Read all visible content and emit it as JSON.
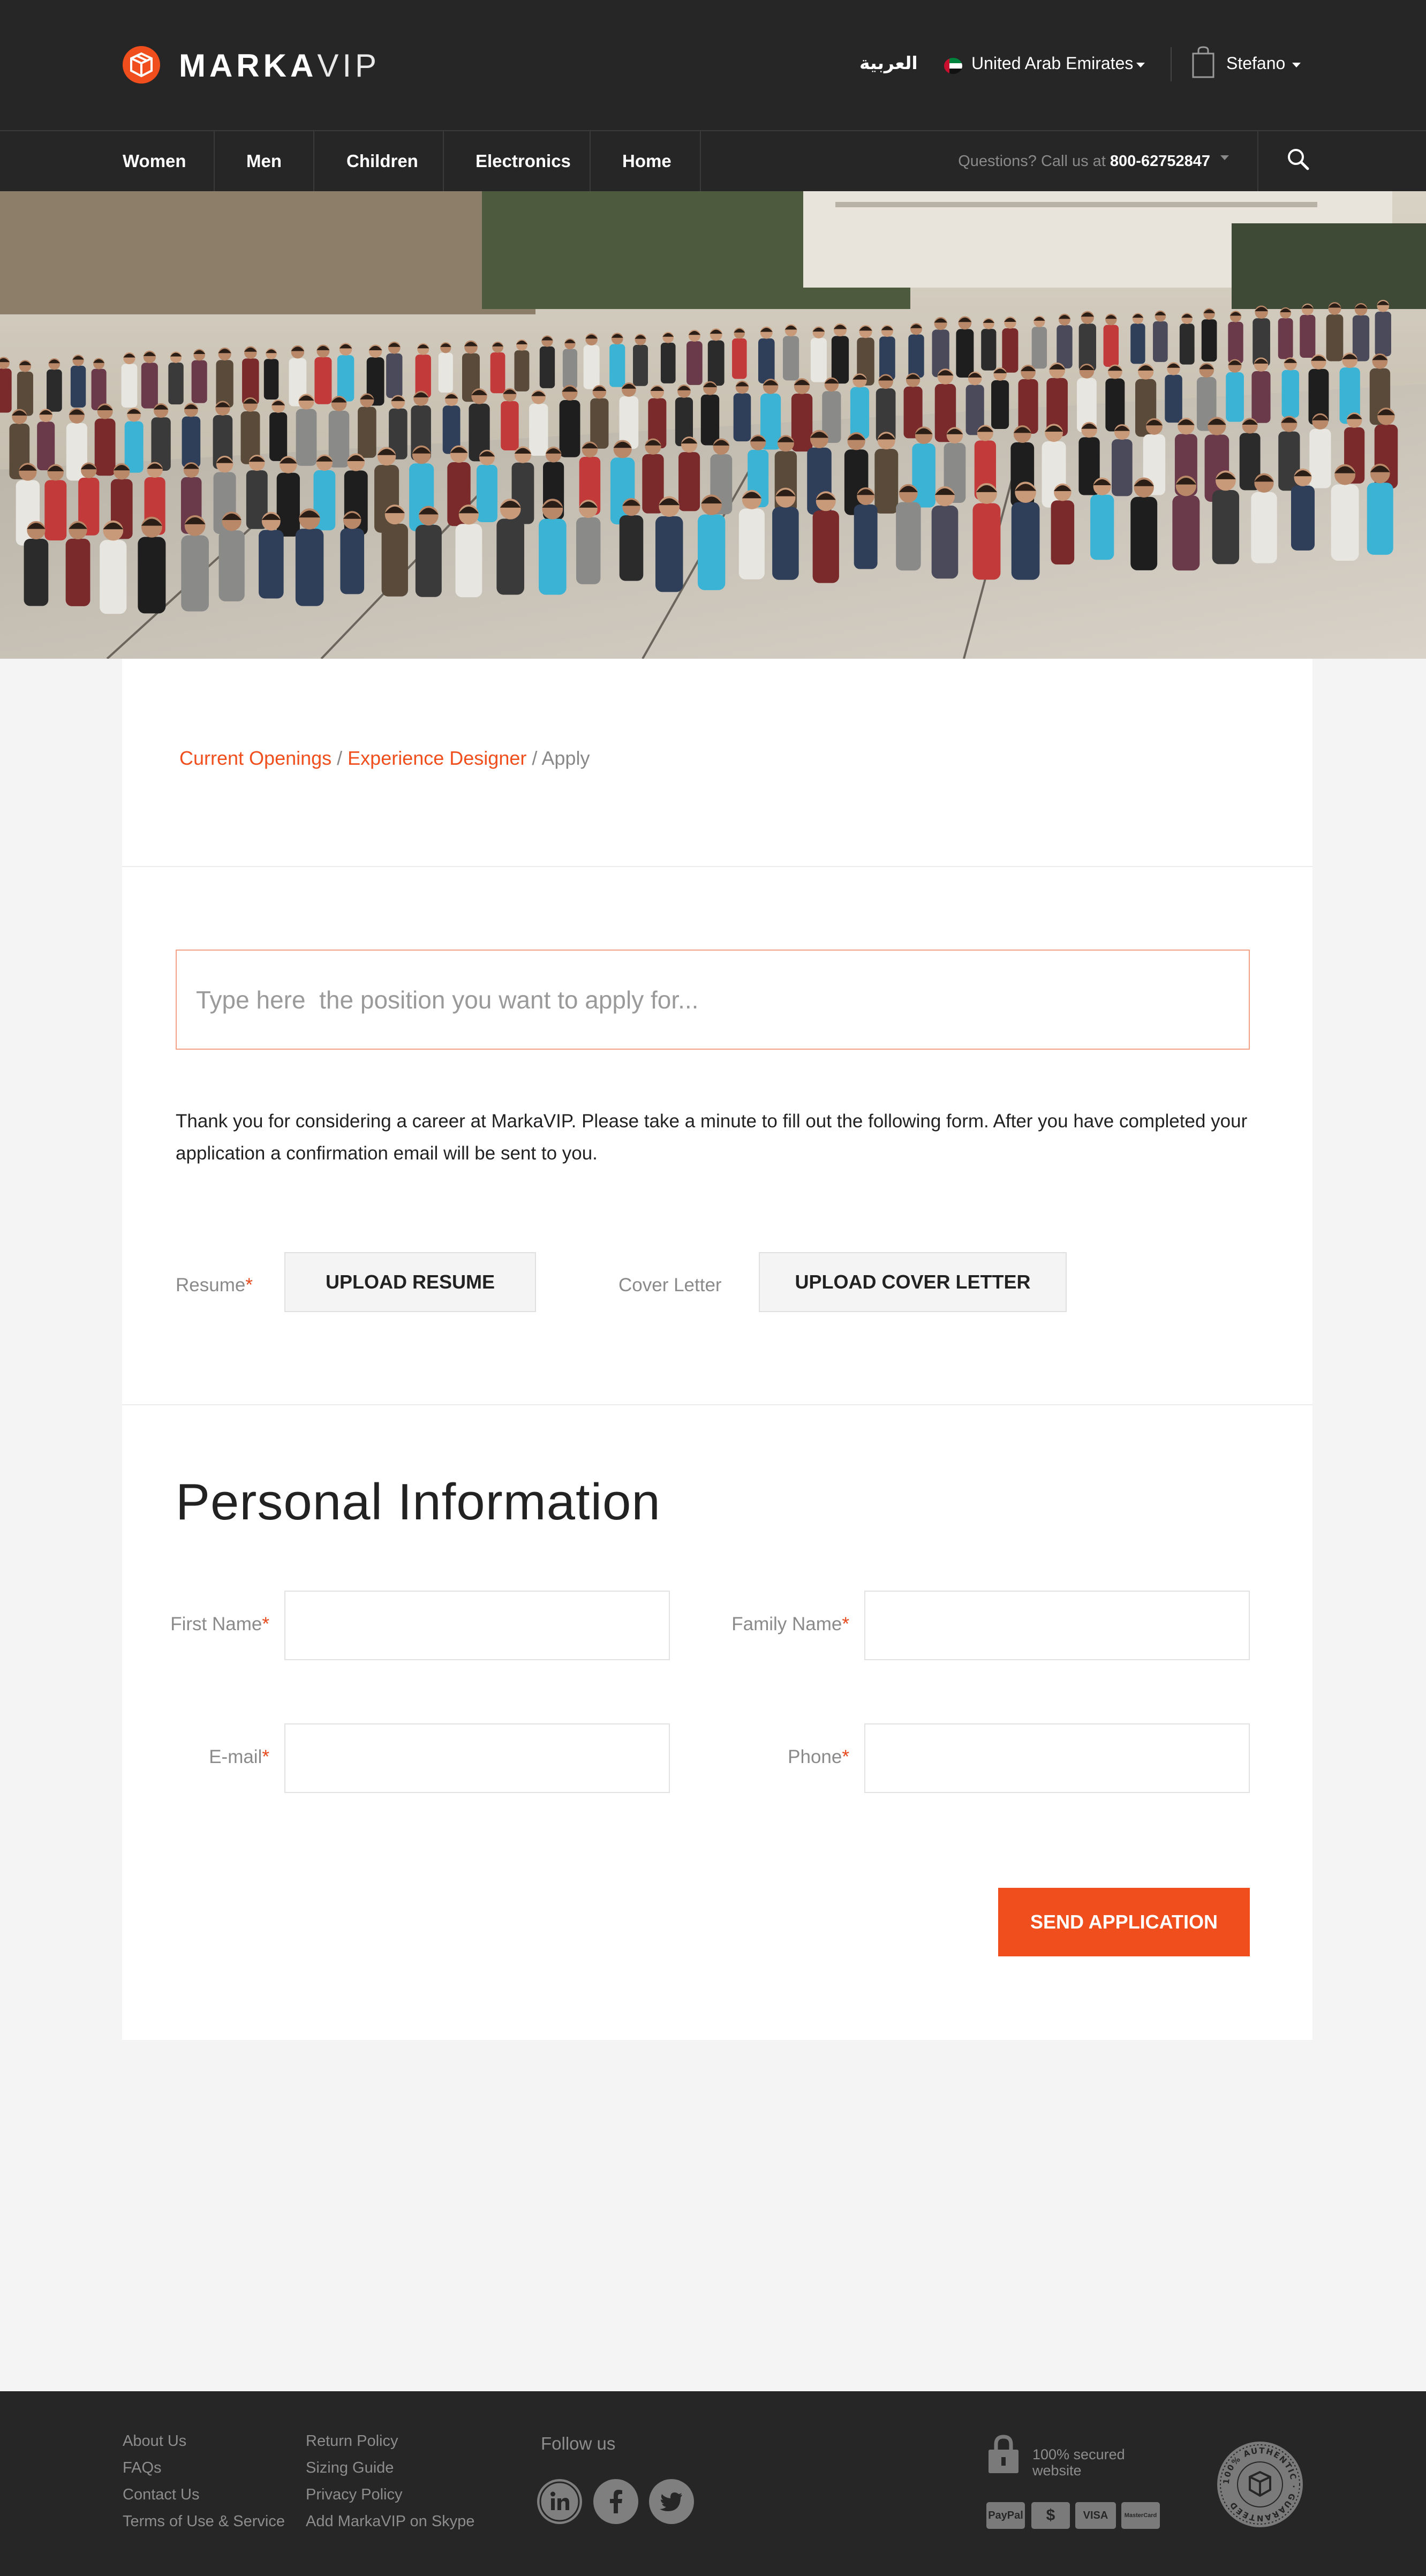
{
  "header": {
    "logo_bold": "MARKA",
    "logo_light": "VIP",
    "arabic_link": "العربية",
    "country": "United Arab Emirates",
    "user": "Stefano"
  },
  "nav": {
    "items": [
      {
        "label": "Women"
      },
      {
        "label": "Men"
      },
      {
        "label": "Children"
      },
      {
        "label": "Electronics"
      },
      {
        "label": "Home"
      }
    ],
    "questions_prefix": "Questions? Call us at ",
    "phone": "800-62752847"
  },
  "breadcrumb": {
    "item1": "Current Openings",
    "sep1": " / ",
    "item2": "Experience Designer",
    "sep2": " / ",
    "current": "Apply"
  },
  "form": {
    "position_placeholder": "Type here  the position you want to apply for...",
    "intro": "Thank you for considering a career at MarkaVIP.  Please take a minute to fill out the following form. After you have completed your application a confirmation email will be sent to you.",
    "resume_label": "Resume",
    "upload_resume": "UPLOAD RESUME",
    "cover_label": "Cover Letter",
    "upload_cover": "UPLOAD COVER LETTER",
    "personal_title": "Personal Information",
    "first_name_label": "First Name",
    "family_name_label": "Family Name",
    "email_label": "E-mail",
    "phone_label": "Phone",
    "required_marker": "*",
    "submit": "SEND APPLICATION"
  },
  "footer": {
    "col1": [
      "About Us",
      "FAQs",
      "Contact Us",
      "Terms of Use & Service"
    ],
    "col2": [
      "Return Policy",
      "Sizing Guide",
      "Privacy Policy",
      "Add MarkaVIP on Skype"
    ],
    "follow": "Follow us",
    "social": [
      "linkedin-icon",
      "facebook-icon",
      "twitter-icon"
    ],
    "secured": "100% secured website",
    "payments": [
      "PayPal",
      "$",
      "VISA",
      "MasterCard"
    ],
    "seal_text": "100% AUTHENTIC · GUARANTEED"
  },
  "colors": {
    "accent": "#f04e1c",
    "header_bg": "#262626",
    "page_bg": "#f4f4f4"
  }
}
